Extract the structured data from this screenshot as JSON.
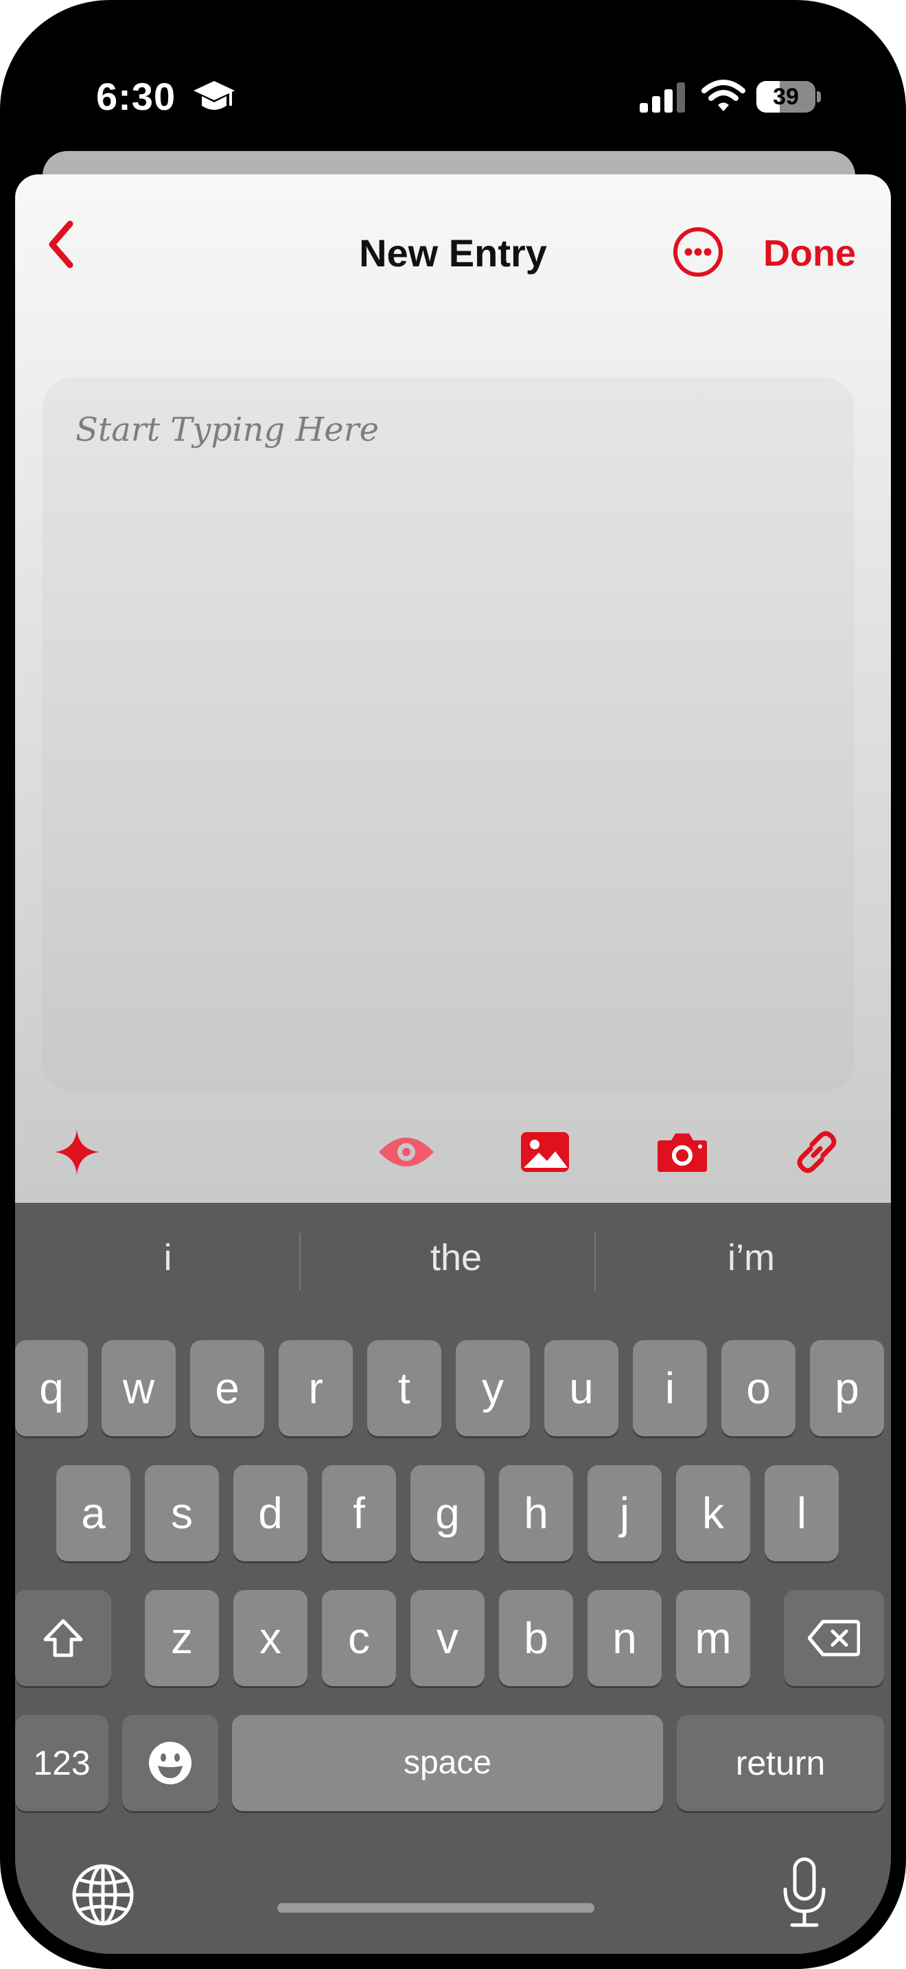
{
  "status_bar": {
    "time": "6:30",
    "battery": "39"
  },
  "nav": {
    "title": "New Entry",
    "done_label": "Done",
    "back_icon": "chevron-left-icon",
    "more_icon": "ellipsis-circle-icon"
  },
  "editor": {
    "placeholder": "Start Typing Here"
  },
  "toolbar": {
    "icons": [
      "sparkle-icon",
      "eye-icon",
      "image-icon",
      "camera-icon",
      "link-icon"
    ]
  },
  "keyboard": {
    "suggestions": [
      "i",
      "the",
      "i’m"
    ],
    "row1": [
      "q",
      "w",
      "e",
      "r",
      "t",
      "y",
      "u",
      "i",
      "o",
      "p"
    ],
    "row2": [
      "a",
      "s",
      "d",
      "f",
      "g",
      "h",
      "j",
      "k",
      "l"
    ],
    "row3": [
      "z",
      "x",
      "c",
      "v",
      "b",
      "n",
      "m"
    ],
    "numbers_label": "123",
    "space_label": "space",
    "return_label": "return"
  },
  "colors": {
    "accent": "#e0101e",
    "keyboard_bg": "#5b5b5b",
    "key_bg": "#8a8a8a"
  }
}
